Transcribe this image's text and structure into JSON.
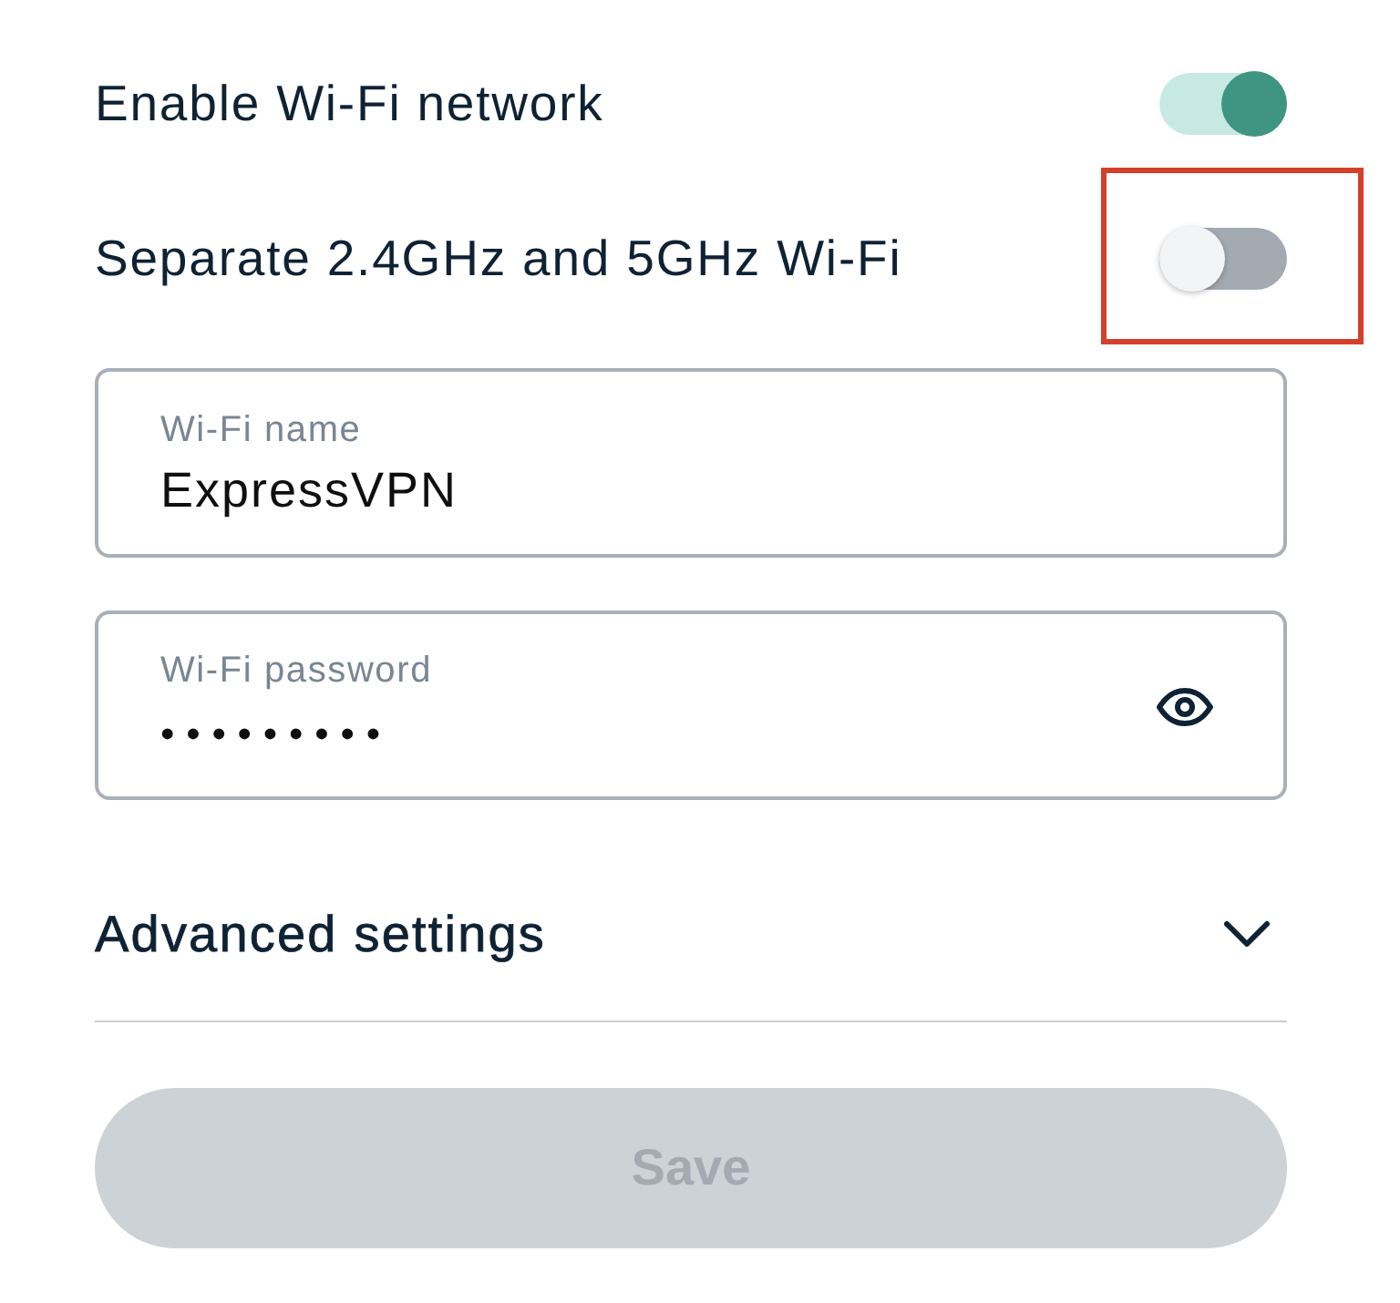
{
  "toggles": [
    {
      "label": "Enable Wi-Fi network",
      "on": true,
      "highlighted": false
    },
    {
      "label": "Separate 2.4GHz and 5GHz Wi-Fi",
      "on": false,
      "highlighted": true
    }
  ],
  "fields": [
    {
      "kind": "text",
      "label": "Wi-Fi name",
      "value": "ExpressVPN"
    },
    {
      "kind": "password",
      "label": "Wi-Fi password",
      "value": "•••••••••"
    }
  ],
  "advanced": {
    "label": "Advanced settings",
    "expanded": false
  },
  "save_button": {
    "label": "Save",
    "disabled": true
  }
}
